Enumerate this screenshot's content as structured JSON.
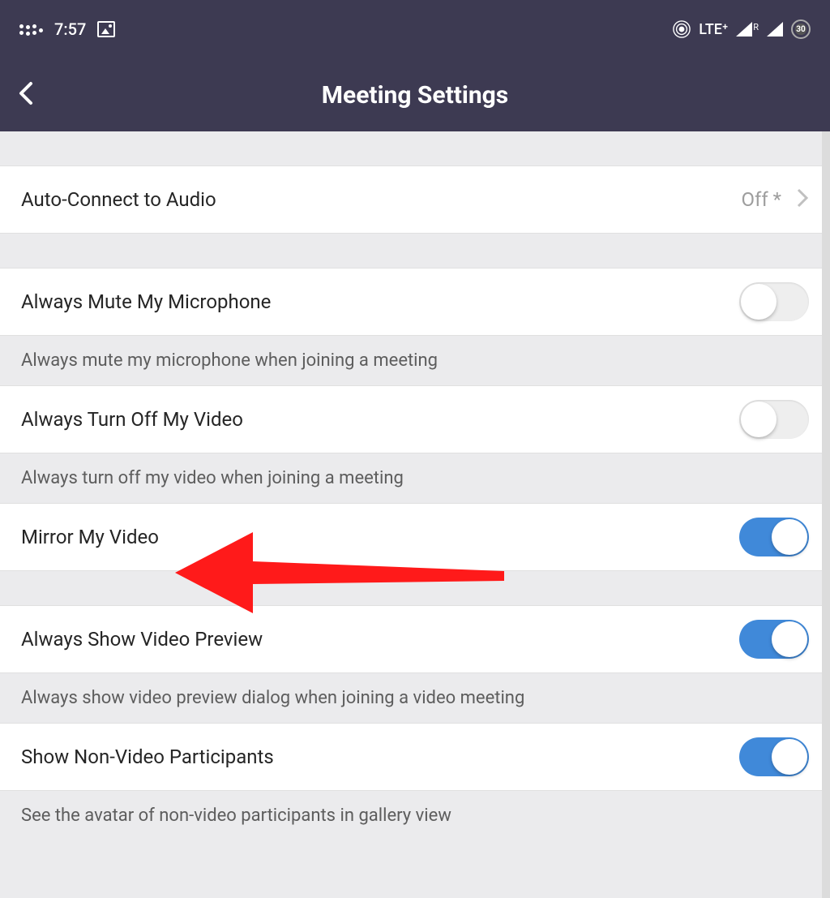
{
  "statusBar": {
    "time": "7:57",
    "network": "LTE⁺",
    "battery": "30"
  },
  "header": {
    "title": "Meeting Settings"
  },
  "settings": {
    "autoConnect": {
      "label": "Auto-Connect to Audio",
      "value": "Off *"
    },
    "muteMic": {
      "label": "Always Mute My Microphone",
      "description": "Always mute my microphone when joining a meeting",
      "enabled": false
    },
    "turnOffVideo": {
      "label": "Always Turn Off My Video",
      "description": "Always turn off my video when joining a meeting",
      "enabled": false
    },
    "mirrorVideo": {
      "label": "Mirror My Video",
      "enabled": true
    },
    "videoPreview": {
      "label": "Always Show Video Preview",
      "description": "Always show video preview dialog when joining a video meeting",
      "enabled": true
    },
    "nonVideoParticipants": {
      "label": "Show Non-Video Participants",
      "description": "See the avatar of non-video participants in gallery view",
      "enabled": true
    }
  }
}
